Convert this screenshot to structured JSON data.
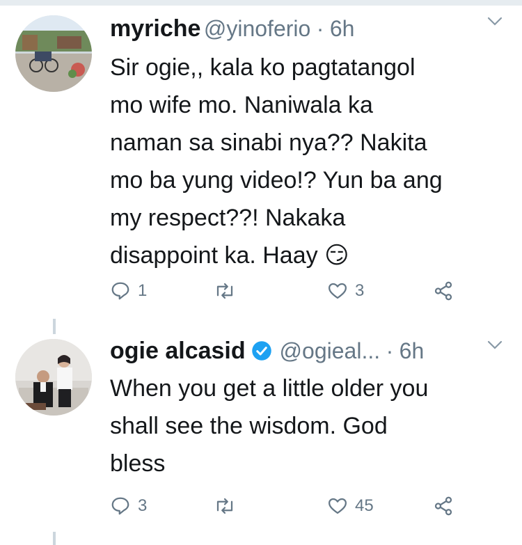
{
  "tweets": [
    {
      "name": "myriche",
      "handle": "@yinoferio",
      "separator": "·",
      "time": "6h",
      "verified": false,
      "text_lines": [
        "Sir ogie,, kala ko pagtatangol",
        "mo wife mo. Naniwala ka",
        "naman sa sinabi nya?? Nakita",
        "mo ba yung video!? Yun ba ang",
        "my respect??! Nakaka",
        "disappoint ka. Haay"
      ],
      "emoji": "😏",
      "reply_count": "1",
      "retweet_count": "",
      "like_count": "3"
    },
    {
      "name": "ogie alcasid",
      "handle": "@ogieal...",
      "separator": "·",
      "time": "6h",
      "verified": true,
      "text_lines": [
        "When you get a little older you",
        "shall see the wisdom. God",
        "bless"
      ],
      "reply_count": "3",
      "retweet_count": "",
      "like_count": "45"
    }
  ],
  "colors": {
    "text": "#14171a",
    "secondary": "#657786",
    "verified": "#1da1f2",
    "thread_line": "#ccd6dd"
  },
  "icons": [
    "reply-icon",
    "retweet-icon",
    "like-icon",
    "share-icon",
    "chevron-down-icon",
    "verified-badge-icon"
  ]
}
